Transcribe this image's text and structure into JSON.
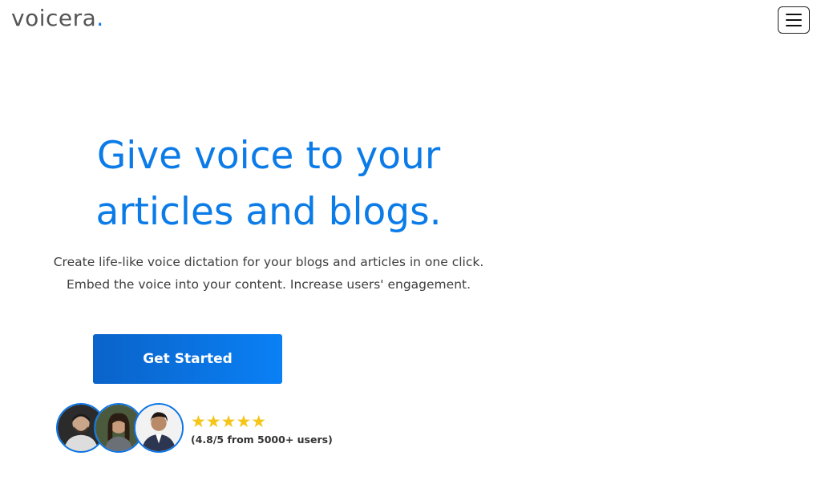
{
  "header": {
    "logo_text": "voicera",
    "logo_dot": ".",
    "menu_icon": "hamburger-menu-icon"
  },
  "hero": {
    "title_line1": "Give voice to your",
    "title_line2": "articles and blogs.",
    "subtitle_line1": "Create life-like voice dictation for your blogs and articles in one click.",
    "subtitle_line2": "Embed the voice into your content. Increase users' engagement.",
    "cta_label": "Get Started"
  },
  "social_proof": {
    "stars": "★★★★★",
    "rating": 4.8,
    "rating_text": "(4.8/5 from 5000+ users)",
    "avatars": [
      "user-avatar",
      "user-avatar",
      "user-avatar"
    ]
  },
  "colors": {
    "accent": "#0b7be8",
    "logo_gray": "#555555",
    "star": "#f5c518"
  }
}
